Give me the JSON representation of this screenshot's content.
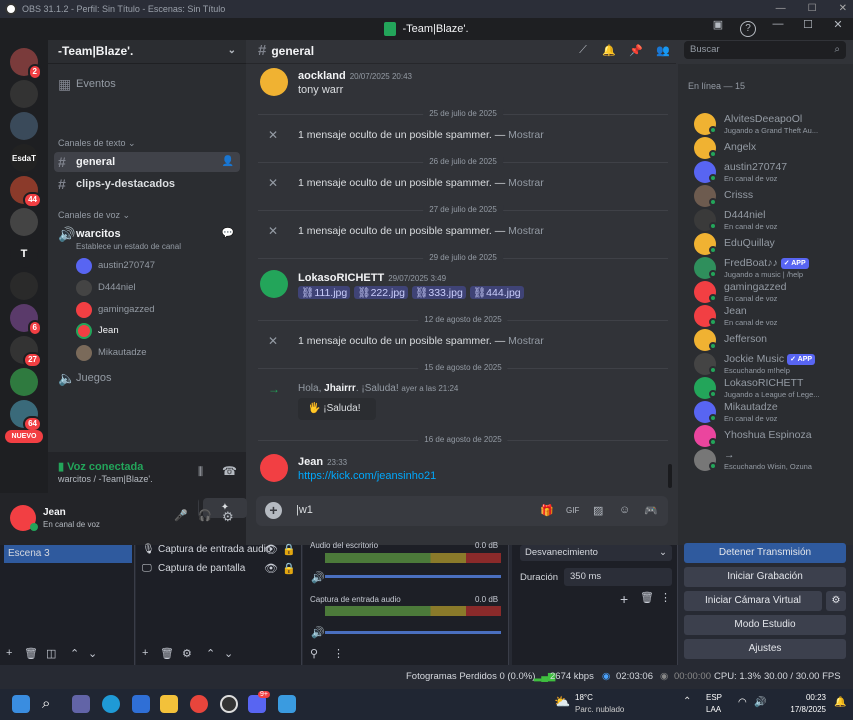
{
  "obs": {
    "title": "OBS 31.1.2 - Perfil: Sin Título - Escenas: Sin Título",
    "scene_item": "Escena 3",
    "sources": [
      "Captura de entrada audio",
      "Captura de pantalla"
    ],
    "mixer": [
      {
        "name": "Audio del escritorio",
        "level": "0.0 dB"
      },
      {
        "name": "Captura de entrada audio",
        "level": "0.0 dB"
      }
    ],
    "transition": "Desvanecimiento",
    "duration_label": "Duración",
    "duration_value": "350 ms",
    "controls": [
      "Detener Transmisión",
      "Iniciar Grabación",
      "Iniciar Cámara Virtual",
      "Modo Estudio",
      "Ajustes"
    ],
    "status": {
      "dropped": "Fotogramas Perdidos 0 (0.0%)",
      "bitrate": "2674 kbps",
      "stream_time": "02:03:06",
      "rec_time": "00:00:00",
      "cpu": "CPU: 1.3%",
      "fps": "30.00 / 30.00 FPS"
    }
  },
  "discord": {
    "window_title": "-Team|Blaze'.",
    "server_name": "-Team|Blaze'.",
    "rail": {
      "servers": [
        {
          "label": "",
          "badge": "2"
        },
        {
          "label": "",
          "badge": ""
        },
        {
          "label": "",
          "badge": ""
        },
        {
          "label": "EsdaT",
          "badge": ""
        },
        {
          "label": "",
          "badge": "44"
        },
        {
          "label": "",
          "badge": ""
        },
        {
          "label": "T",
          "badge": ""
        },
        {
          "label": "",
          "badge": ""
        },
        {
          "label": "",
          "badge": "6"
        },
        {
          "label": "",
          "badge": "27"
        },
        {
          "label": "",
          "badge": ""
        },
        {
          "label": "",
          "badge": "64"
        }
      ],
      "new_label": "NUEVO"
    },
    "sidebar": {
      "events": "Eventos",
      "text_category": "Canales de texto",
      "text_channels": [
        "general",
        "clips-y-destacados"
      ],
      "voice_category": "Canales de voz",
      "voice_channel": "warcitos",
      "voice_status": "Establece un estado de canal",
      "voice_users": [
        "austin270747",
        "D444niel",
        "gamingazzed",
        "Jean",
        "Mikautadze"
      ],
      "other_voice": "Juegos"
    },
    "voice_panel": {
      "status": "Voz conectada",
      "location": "warcitos / -Team|Blaze'."
    },
    "user_panel": {
      "name": "Jean",
      "status": "En canal de voz"
    },
    "chat": {
      "channel": "general",
      "search_placeholder": "Buscar",
      "messages": [
        {
          "kind": "msg",
          "author": "aockland",
          "time": "20/07/2025 20:43",
          "text": "tony warr"
        },
        {
          "kind": "date",
          "text": "25 de julio de 2025"
        },
        {
          "kind": "hidden",
          "text": "1 mensaje oculto de un posible spammer. —",
          "show": "Mostrar"
        },
        {
          "kind": "date",
          "text": "26 de julio de 2025"
        },
        {
          "kind": "hidden",
          "text": "1 mensaje oculto de un posible spammer. —",
          "show": "Mostrar"
        },
        {
          "kind": "date",
          "text": "27 de julio de 2025"
        },
        {
          "kind": "hidden",
          "text": "1 mensaje oculto de un posible spammer. —",
          "show": "Mostrar"
        },
        {
          "kind": "date",
          "text": "29 de julio de 2025"
        },
        {
          "kind": "attach",
          "author": "LokasoRICHETT",
          "time": "29/07/2025 3:49",
          "files": [
            "111.jpg",
            "222.jpg",
            "333.jpg",
            "444.jpg"
          ]
        },
        {
          "kind": "date",
          "text": "12 de agosto de 2025"
        },
        {
          "kind": "hidden",
          "text": "1 mensaje oculto de un posible spammer. —",
          "show": "Mostrar"
        },
        {
          "kind": "date",
          "text": "15 de agosto de 2025"
        },
        {
          "kind": "join",
          "prefix": "Hola,",
          "user": "Jhairrr",
          "suffix": ". ¡Saluda!",
          "time": "ayer a las 21:24",
          "button": "¡Saluda!"
        },
        {
          "kind": "date",
          "text": "16 de agosto de 2025"
        },
        {
          "kind": "msg",
          "author": "Jean",
          "time": "23:33",
          "text": "https://kick.com/jeansinho21"
        }
      ],
      "input_value": "|w1"
    },
    "members": {
      "header": "En línea — 15",
      "list": [
        {
          "name": "AlvitesDeeapoOl",
          "status": "Jugando a Grand Theft Au...",
          "app": false,
          "color": "#f0b232"
        },
        {
          "name": "Angelx",
          "status": "",
          "app": false,
          "color": "#f0b232"
        },
        {
          "name": "austin270747",
          "status": "En canal de voz",
          "app": false,
          "color": "#5865f2"
        },
        {
          "name": "Crisss",
          "status": "",
          "app": false,
          "color": "#6d5b4f"
        },
        {
          "name": "D444niel",
          "status": "En canal de voz",
          "app": false,
          "color": "#3a3a3a"
        },
        {
          "name": "EduQuillay",
          "status": "",
          "app": false,
          "color": "#f0b232"
        },
        {
          "name": "FredBoat♪♪",
          "status": "Jugando a music | /help",
          "app": true,
          "color": "#2f8f5c"
        },
        {
          "name": "gamingazzed",
          "status": "En canal de voz",
          "app": false,
          "color": "#f23f43"
        },
        {
          "name": "Jean",
          "status": "En canal de voz",
          "app": false,
          "color": "#f23f43"
        },
        {
          "name": "Jefferson",
          "status": "",
          "app": false,
          "color": "#f0b232"
        },
        {
          "name": "Jockie Music",
          "status": "Escuchando m!help",
          "app": true,
          "color": "#444"
        },
        {
          "name": "LokasoRICHETT",
          "status": "Jugando a League of Lege...",
          "app": false,
          "color": "#23a55a"
        },
        {
          "name": "Mikautadze",
          "status": "En canal de voz",
          "app": false,
          "color": "#5865f2"
        },
        {
          "name": "Yhoshua Espinoza",
          "status": "",
          "app": false,
          "color": "#eb459e"
        },
        {
          "name": "→",
          "status": "Escuchando Wisin, Ozuna",
          "app": false,
          "color": "#777"
        }
      ],
      "app_label": "APP"
    }
  },
  "taskbar": {
    "weather_temp": "18°C",
    "weather_desc": "Parc. nublado",
    "lang": "ESP",
    "region": "LAA",
    "time": "00:23",
    "date": "17/8/2025",
    "discord_badge": "9+"
  }
}
